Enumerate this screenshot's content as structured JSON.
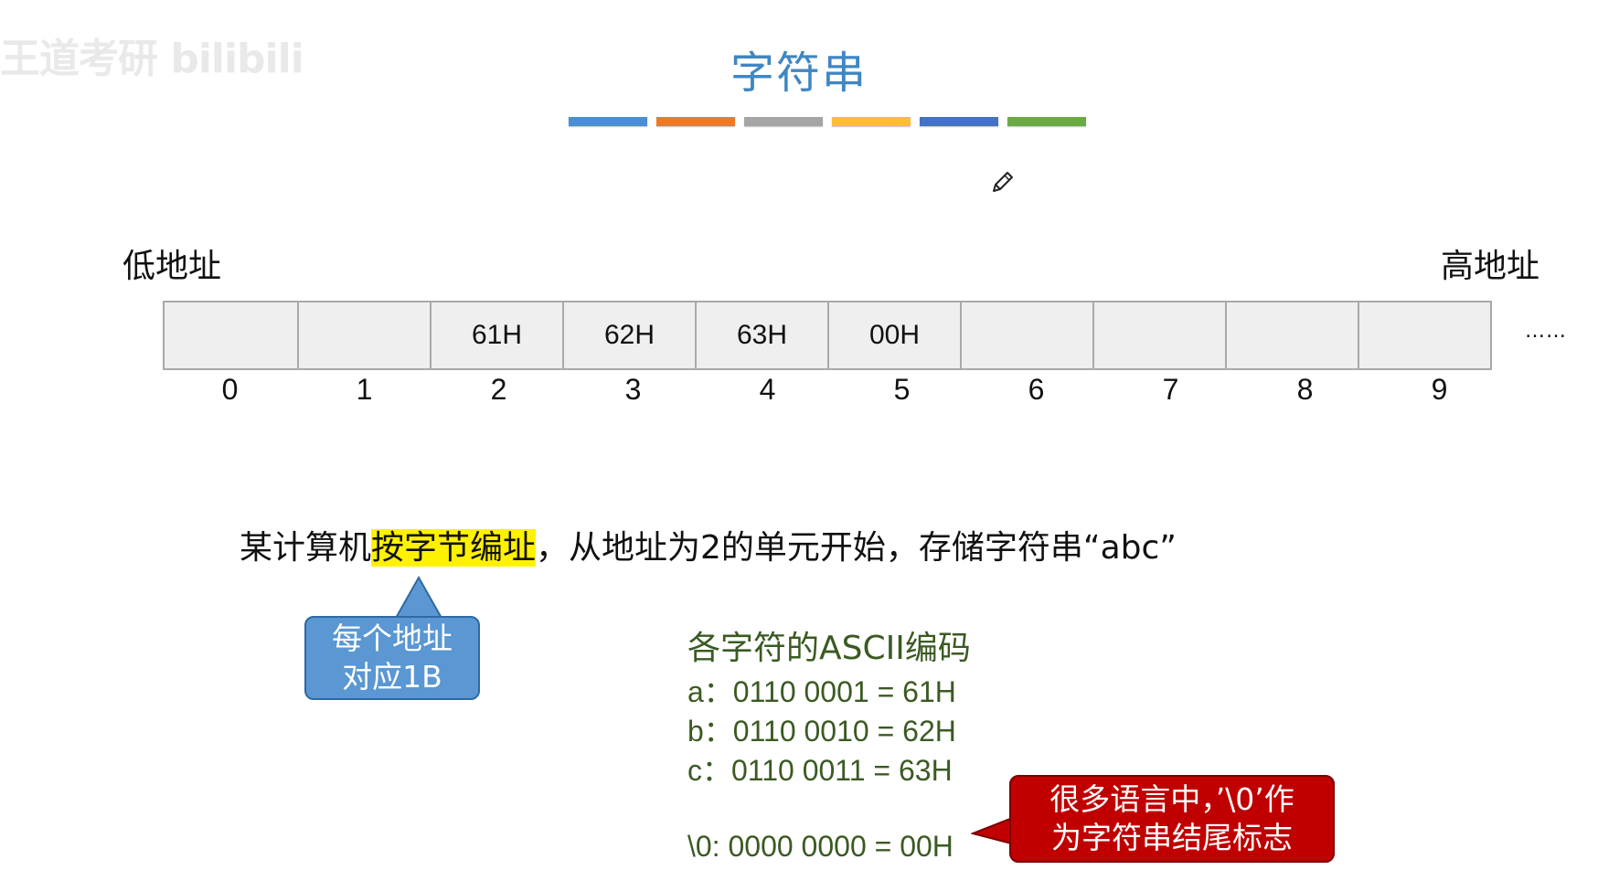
{
  "watermark": "王道考研 bilibili",
  "title": "字符串",
  "accent_bar_colors": [
    "#4a8fd4",
    "#ea7b2a",
    "#a5a5a5",
    "#fdbf2d",
    "#4472c4",
    "#6aaa45"
  ],
  "icons": {
    "cursor": "pencil-icon"
  },
  "memory": {
    "low_label": "低地址",
    "high_label": "高地址",
    "cells": [
      "",
      "",
      "61H",
      "62H",
      "63H",
      "00H",
      "",
      "",
      "",
      ""
    ],
    "indices": [
      "0",
      "1",
      "2",
      "3",
      "4",
      "5",
      "6",
      "7",
      "8",
      "9"
    ],
    "ellipsis": "……"
  },
  "statement": {
    "before": "某计算机",
    "highlight": "按字节编址",
    "after": "，从地址为2的单元开始，存储字符串“abc”",
    "highlight_color": "#fff200"
  },
  "callout_blue": {
    "line1": "每个地址",
    "line2": "对应1B",
    "color": "#5a97d3"
  },
  "ascii": {
    "heading": "各字符的ASCII编码",
    "rows": [
      "a：0110 0001 = 61H",
      "b：0110 0010 = 62H",
      "c：0110 0011 = 63H",
      "\\0: 0000 0000 = 00H"
    ],
    "color": "#3b5a22"
  },
  "callout_red": {
    "line1": "很多语言中，’\\0’作",
    "line2": "为字符串结尾标志",
    "color": "#c00000"
  }
}
